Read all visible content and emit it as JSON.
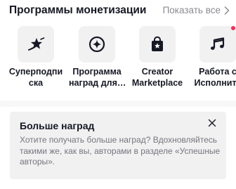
{
  "header": {
    "title": "Программы монетизации",
    "show_all_label": "Показать все"
  },
  "programs": [
    {
      "line1": "Суперподпи",
      "line2": "ска",
      "icon": "star-rocket-icon"
    },
    {
      "line1": "Программа",
      "line2": "наград для…",
      "icon": "sparkle-circle-icon"
    },
    {
      "line1": "Creator",
      "line2": "Marketplace",
      "icon": "shopping-bag-star-icon"
    },
    {
      "line1": "Работа с",
      "line2": "Исполните",
      "icon": "music-notes-icon",
      "has_badge": true
    }
  ],
  "rewards_card": {
    "title": "Больше наград",
    "text": "Хотите получать больше наград? Вдохновляйтесь такими же, как вы, авторами в разделе «Успешные авторы»."
  },
  "colors": {
    "accent_badge": "#fe2c55",
    "tile_background": "#f1f1f2",
    "muted_text": "#8a8b91"
  }
}
